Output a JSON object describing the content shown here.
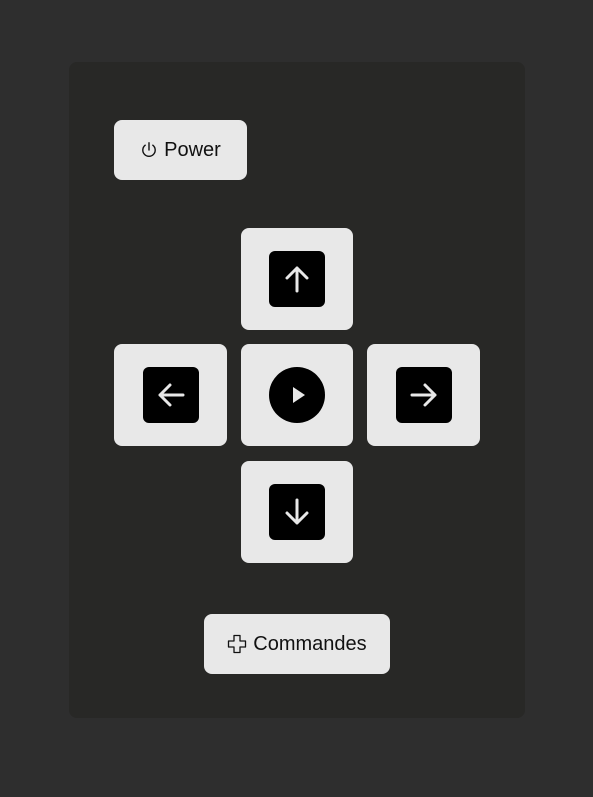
{
  "power": {
    "label": "Power",
    "icon": "power-icon"
  },
  "dpad": {
    "up_icon": "arrow-up-icon",
    "left_icon": "arrow-left-icon",
    "center_icon": "play-icon",
    "right_icon": "arrow-right-icon",
    "down_icon": "arrow-down-icon"
  },
  "commands": {
    "label": "Commandes",
    "icon": "plus-cross-icon"
  },
  "colors": {
    "background": "#2e2e2e",
    "panel": "#282826",
    "button": "#e8e8e8",
    "icon_fill": "#000000",
    "icon_stroke": "#e8e8e8"
  }
}
